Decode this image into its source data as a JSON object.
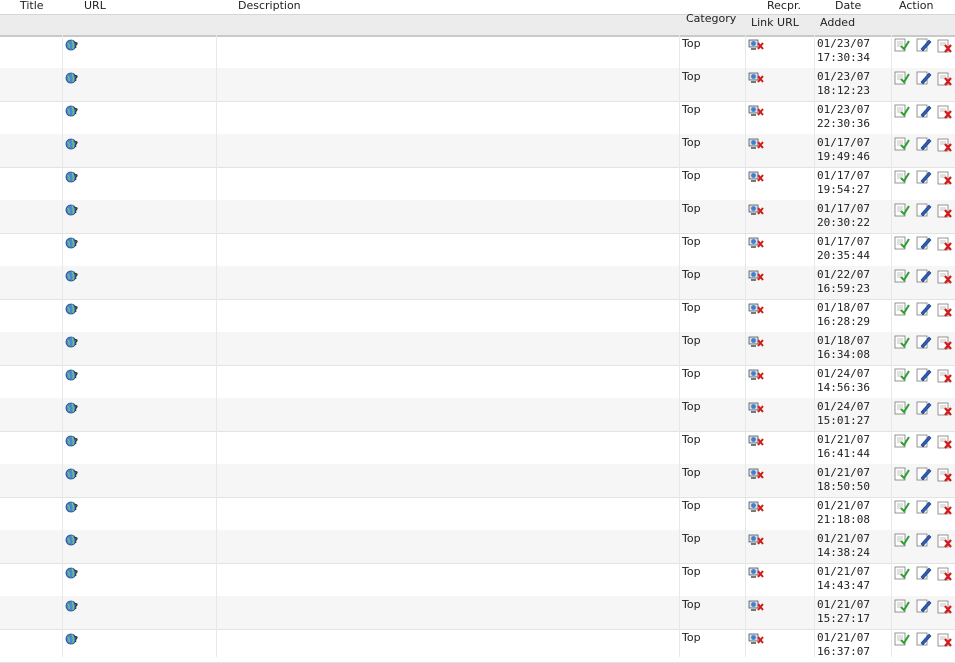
{
  "header": {
    "title": "Title",
    "url": "URL",
    "description": "Description",
    "category": "Category",
    "recpr_line1": "Recpr.",
    "recpr_line2": "Link URL",
    "date_line1": "Date",
    "date_line2": "Added",
    "action": "Action"
  },
  "icons": {
    "url": "url-preview-globe-icon",
    "recpr": "reciprocal-link-missing-icon",
    "approve": "approve-icon",
    "edit": "edit-icon",
    "delete": "delete-icon"
  },
  "rows": [
    {
      "category": "Top",
      "date": "01/23/07",
      "time": "17:30:34"
    },
    {
      "category": "Top",
      "date": "01/23/07",
      "time": "18:12:23"
    },
    {
      "category": "Top",
      "date": "01/23/07",
      "time": "22:30:36"
    },
    {
      "category": "Top",
      "date": "01/17/07",
      "time": "19:49:46"
    },
    {
      "category": "Top",
      "date": "01/17/07",
      "time": "19:54:27"
    },
    {
      "category": "Top",
      "date": "01/17/07",
      "time": "20:30:22"
    },
    {
      "category": "Top",
      "date": "01/17/07",
      "time": "20:35:44"
    },
    {
      "category": "Top",
      "date": "01/22/07",
      "time": "16:59:23"
    },
    {
      "category": "Top",
      "date": "01/18/07",
      "time": "16:28:29"
    },
    {
      "category": "Top",
      "date": "01/18/07",
      "time": "16:34:08"
    },
    {
      "category": "Top",
      "date": "01/24/07",
      "time": "14:56:36"
    },
    {
      "category": "Top",
      "date": "01/24/07",
      "time": "15:01:27"
    },
    {
      "category": "Top",
      "date": "01/21/07",
      "time": "16:41:44"
    },
    {
      "category": "Top",
      "date": "01/21/07",
      "time": "18:50:50"
    },
    {
      "category": "Top",
      "date": "01/21/07",
      "time": "21:18:08"
    },
    {
      "category": "Top",
      "date": "01/21/07",
      "time": "14:38:24"
    },
    {
      "category": "Top",
      "date": "01/21/07",
      "time": "14:43:47"
    },
    {
      "category": "Top",
      "date": "01/21/07",
      "time": "15:27:17"
    },
    {
      "category": "Top",
      "date": "01/21/07",
      "time": "16:37:07"
    }
  ]
}
